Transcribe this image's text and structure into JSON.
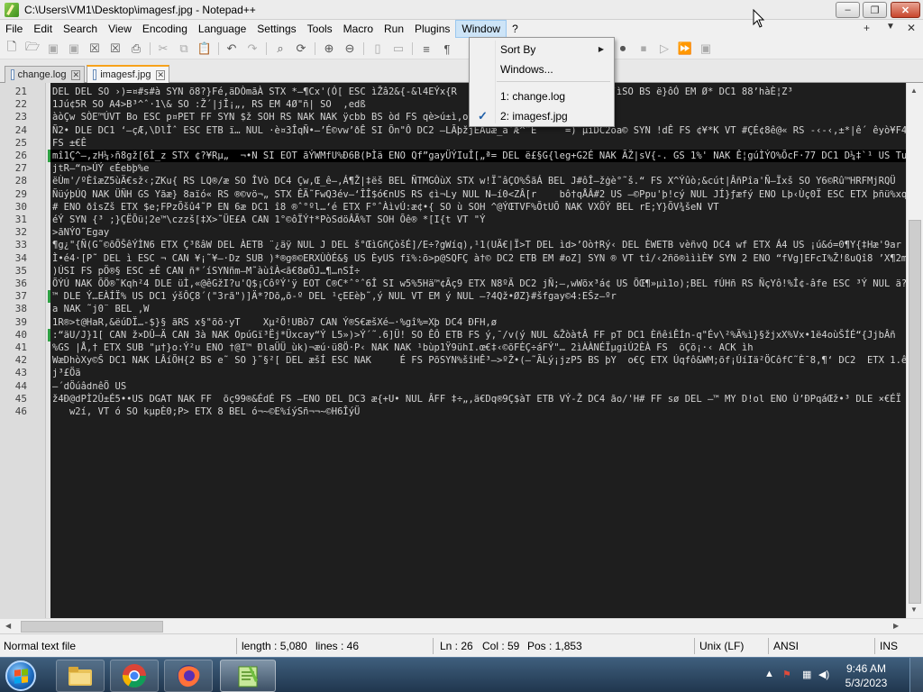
{
  "window": {
    "title": "C:\\Users\\VM1\\Desktop\\imagesf.jpg - Notepad++",
    "minimize": "–",
    "maximize": "❐",
    "close": "✕"
  },
  "menubar": {
    "items": [
      "File",
      "Edit",
      "Search",
      "View",
      "Encoding",
      "Language",
      "Settings",
      "Tools",
      "Macro",
      "Run",
      "Plugins",
      "Window",
      "?"
    ],
    "plus": "+",
    "arrow": "▼",
    "close": "✕"
  },
  "tabs": [
    {
      "label": "change.log"
    },
    {
      "label": "imagesf.jpg"
    }
  ],
  "window_menu": {
    "sort_by": "Sort By",
    "windows": "Windows...",
    "doc1": "1: change.log",
    "doc2": "2: imagesf.jpg",
    "check": "✓"
  },
  "editor": {
    "current_line": 26,
    "lines": [
      {
        "n": "21",
        "text": "DEL DEL SO ›)=¤#s#à SYN õ8?}Fé,äDÒmãÀ STX *–¶Cx'(Ó[ ESC ìŽâ2&{-&l4EÝx{R        SOH €M#e–EÔ¡Ÿ²'H¢bJ¨ìSO BS ë}ôÓ EM Ø* DC1 88’hàÈ¦Z³"
      },
      {
        "n": "22",
        "text": "1Jú¢5R SO A4>B³^ˆ·1\\& SO :Ž´|jÎ¡„, RS EM 4Ø\"ñ| SO  ,edß"
      },
      {
        "n": "23",
        "text": "àòÇw SÒE™ÚVT Bo ESC p¤PET FF SYN $ž SOH RS NAK NAK ÿcbb BS òd FS qè>ú±ì,o"
      },
      {
        "n": "24",
        "text": "Ñ2• DLE DC1 ‘–çÆ,\\DlÎˆ ESC ETB ï… NUL ·è¤3ÎqÑ•–’É©vw’ðÊ SI Õn\"Ô DC2 –LÃþžjÈÂuæ_a`Æ^ˆE     =)˜µìDC2oa© SYN !dÊ FS ¢¥*K VT #ÇÉ¢8ê@« RS -‹-‹,±*|ê´ êyò¥F4˜"
      },
      {
        "n": "25",
        "text": "FS ±€Ê"
      },
      {
        "n": "26",
        "text": "mî1Ç^–,zH¼›ñ8gž[6Ì_z STX ¢?¥Rµ„  ¬•N SI EOT ãÝWMfU%Ð6B(ÞÌä ENO Qf”gayÜÝIuÎ[„ª= DEL ë£§G{leg+G2É NAK ÃŽ|sV{-. GS 1%' NAK Ê¦gúÌÝO%ÕcF·77 DC1 D¼‡`¹ US Tu"
      },
      {
        "n": "27",
        "text": "jtR–“n>ÚÝ ϵÉebþ%e"
      },
      {
        "n": "28",
        "text": "ëÙm'/ºÈîæZ5ùÄ€sž‹;ZKu{ RS LQ®/æ SO ÎVò DC4 Çw,Œ_ê–,Á¶Ž|‡ëš BEL ÑTMGÒùX STX w!Ï˜âÇO%ŠãÁ BEL J#ôÎ–žġè°˜š.“ FS X^Ýûò;&cút|ÂñPîa'Ñ–Ïxš SO Y6©Rû™HRFMjRQÜ"
      },
      {
        "n": "29",
        "text": "ÑüýþÚQ NAK ÜÑH GS Yãæ} 8aïó« RS ®©vö¬„ STX ÊÄ˜FwQ3év—‘ÎÎ$ó€nUS RS ¢ì¬Ly NUL N–í0<ZÂ[r    bô†qÅÂ#2 US –©Ppu'þ!cý NUL JÍ}ƒæfý ENO Lþ‹Ùç0Ï ESC ETX þñü%xqú/x"
      },
      {
        "n": "30",
        "text": "# ENO ðîsZš ETX $e;FPzÕšû4˜P EN 6æ DC1 î8 ®ˆ°ºl…‘é ETX F°ˆÀìvÚ:æ¢•{ SO ù SOH ^@ÝŒTVF%ÕtUÕ NAK VXÕÝ BEL rE;Y}ÕV¾šeN VT"
      },
      {
        "n": "31",
        "text": "éÝ SYN {³ ;}ÇËÕü¦2e™\\czzš[‡X>˜ÜE£A CAN 1°©ôÏÝ†*PòSdöÂÃ%T SOH Õê® *[I{t VT \"Ý"
      },
      {
        "n": "32",
        "text": ">ãNÝO˜Egay"
      },
      {
        "n": "33",
        "text": "¶g¿\"{Ñ(G˜©õÕŠêÝÌN6 ETX Ç³ßâW DEL ÀETB ¨¿äÿ NUL J DEL š°ŒìGñÇòšÉ]/E÷?gWíq),¹1(UÄ€|Ï>T DEL ìd>’Oò†Rý‹ DEL ÈWETB vèñvQ DC4 wf ETX Á4 US ¡ú&ó=0¶Y{‡Hæ'9ar"
      },
      {
        "n": "34",
        "text": "Ì•é4·[P˜ DEL ì ESC ¬ CAN ¥¡˜¥–·Dz SUB )*®g®©ERXÙÒÉ&§ US ÈyUS fï%:õ>p@SQFÇ à†© DC2 ETB EM #oZ] SYN ® VT tî/‹2ñõ®ìììÈ¥ SYN 2 ENO “fVg]EFcI%Ž!ßuQî8 ’X¶2mí“"
      },
      {
        "n": "35",
        "text": ")ÚSI FS pÖ®§ ESC ±Ê CAN ñ*´íSYNñm–M˜àùîÀ<ã€8øÕJ…¶…nSÍ÷"
      },
      {
        "n": "36",
        "text": "ÕÝÚ NAK ÕÖ®˜Kqh²4 DLE üÌ,«@êGžI?u'Q$¡CôºÝ'ÿ EOT C®C*ˆ°ˆ6Î SI w5%5Hä™¢Ãç9 ETX N8ºÄ DC2 jÑ;–,wWõx³á¢ US ÕŒ¶»µì1o);BEL fÚHñ RS ÑçYô!%Î¢-âfe ESC ³Ý NUL ä?"
      },
      {
        "n": "37",
        "text": "™ DLE Ý…EÀÍÏ% US DC1 ýšÔÇ8´(\"3rã\")]Ä*?Dõ„õ-º DEL ¹çEEèþ˜,ý NUL VT EM ý NUL –?4Qž•ØZ}#šfgay©4:EŠz–ºr"
      },
      {
        "n": "38",
        "text": "a NAK ˜j0¨ BEL ,W"
      },
      {
        "n": "39",
        "text": "1R®>t@HaR,&ëúDÏ…-$}§ ãRS x§\"õõ·yT    Xµ²Õ!UBò7 CAN Ý®S€æšXé–·%gî%=Xþ DC4 ÐFH,ø"
      },
      {
        "n": "40",
        "text": ":“äU/J}1[ CAN ž×DÛ–Ä CAN 3à NAK OpúGï³Ëj*Üxcay“Ý L5»)>Ý´˜.6]Ü! SO ÊÔ ETB FS ý,¯/v(ý NUL &ŽòàtÂ FF pT DC1 ÈñêiÊÍn-q\"Év\\²%Ã%ì}§žjxX%Vx•1ë4oùŠÍÉ“{JjbÂñ"
      },
      {
        "n": "41",
        "text": "%GS |Å,† ETX SUB \"µ†}o:Ý²u ENO †@I™ ÐlaÜÜ_ùk)¬æú·ü8Ö·P‹ NAK NAK ¹bùp1Ÿ9ühI.œ€‡‹©õFÈÇ÷áFÝ\"… 2ìÀÀNÉÏµgiÚ2ÈÀ FS  õÇõ¡·‹ ACK ìh"
      },
      {
        "n": "42",
        "text": "WæDhòXy©Š DC1 NAK LÂíÖH{2 BS e˜ SO }˜§²[ DEL æšÍ ESC NAK     É FS PõSYN%šîHÊ³–>ºŽ•(–˜ÃLý¡jzP5 BS þY  o€Ç ETX Úqfô&WM;õf¡ÚíIä²ÖCôfC˜È¯8,¶‘ DC2  ETX 1.ê"
      },
      {
        "n": "43",
        "text": "j³£Öä"
      },
      {
        "n": "44",
        "text": "–´dÖúâdnêÖ US"
      },
      {
        "n": "45",
        "text": "ž4Ð@dPÌ2Û±É5••US DGAT NAK FF  õç99®&ÉdÉ FS –ENO DEL DC3 æ{+U• NUL ÂFF ‡÷„,ä€Dq®9Ç$àT ETB VÝ-Ž DC4 ão/'H# FF sø DEL –™ MY D!ol ENO Ù’ÐPqáŒž•³ DLE ×€ÉÏ DEL ®<å"
      },
      {
        "n": "46",
        "text": "   w2í, VT ó SO kµpÈ0;P> ETX 8 BEL ó¬~©E%íýSñ¬¬~©H6ÎýÜ"
      }
    ]
  },
  "statusbar": {
    "filetype": "Normal text file",
    "length": "length : 5,080",
    "lines": "lines : 46",
    "ln": "Ln : 26",
    "col": "Col : 59",
    "pos": "Pos : 1,853",
    "eol": "Unix (LF)",
    "encoding": "ANSI",
    "mode": "INS"
  },
  "taskbar": {
    "time": "9:46 AM",
    "date": "5/3/2023",
    "tray_arrow": "▲"
  }
}
